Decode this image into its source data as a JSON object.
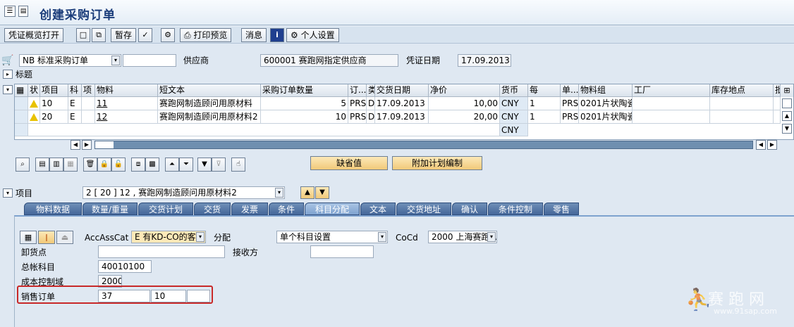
{
  "window": {
    "title": "创建采购订单"
  },
  "toolbar": {
    "buttons": [
      {
        "label": "凭证概览打开"
      },
      {
        "label": "暂存"
      },
      {
        "label": "打印预览"
      },
      {
        "label": "消息"
      },
      {
        "label": "个人设置"
      }
    ]
  },
  "header": {
    "doc_type": "NB 标准采购订单",
    "doc_type_extra": "",
    "vendor_label": "供应商",
    "vendor_value": "600001 赛跑网指定供应商",
    "doc_date_label": "凭证日期",
    "doc_date_value": "17.09.2013",
    "section_label": "标题"
  },
  "grid": {
    "columns": [
      "状",
      "项目",
      "科",
      "项",
      "物料",
      "短文本",
      "采购订单数量",
      "订...",
      "类",
      "交货日期",
      "净价",
      "货币",
      "每",
      "单...",
      "物料组",
      "工厂",
      "库存地点",
      "批"
    ],
    "rows": [
      {
        "item": "10",
        "acct": "E",
        "cat": "",
        "material": "11",
        "text": "赛跑网制造顾问用原材料",
        "qty": "5",
        "unit": "PRS",
        "type": "D",
        "date": "17.09.2013",
        "price": "10,00",
        "currency": "CNY",
        "per": "1",
        "unit2": "PRS",
        "matgroup": "0201",
        "plant": "片状陶瓷赛跑网顾问制造工厂"
      },
      {
        "item": "20",
        "acct": "E",
        "cat": "",
        "material": "12",
        "text": "赛跑网制造顾问用原材料2",
        "qty": "10",
        "unit": "PRS",
        "type": "D",
        "date": "17.09.2013",
        "price": "20,00",
        "currency": "CNY",
        "per": "1",
        "unit2": "PRS",
        "matgroup": "0201",
        "plant": "片状陶瓷赛跑网顾问制造工厂"
      },
      {
        "item": "",
        "acct": "",
        "cat": "",
        "material": "",
        "text": "",
        "qty": "",
        "unit": "",
        "type": "",
        "date": "",
        "price": "",
        "currency": "CNY",
        "per": "",
        "unit2": "",
        "matgroup": "",
        "plant": ""
      }
    ]
  },
  "actions": {
    "default_values": "缺省值",
    "additional_planning": "附加计划编制"
  },
  "item_selector": {
    "label": "项目",
    "value": "2 [ 20 ] 12 , 赛跑网制造顾问用原材料2"
  },
  "tabs": [
    {
      "label": "物料数据"
    },
    {
      "label": "数量/重量"
    },
    {
      "label": "交货计划"
    },
    {
      "label": "交货"
    },
    {
      "label": "发票"
    },
    {
      "label": "条件"
    },
    {
      "label": "科目分配",
      "active": true
    },
    {
      "label": "文本"
    },
    {
      "label": "交货地址"
    },
    {
      "label": "确认"
    },
    {
      "label": "条件控制"
    },
    {
      "label": "零售"
    }
  ],
  "account": {
    "accasscat_label": "AccAssCat",
    "accasscat_value": "E 有KD-CO的客...",
    "distribution_label": "分配",
    "distribution_value": "单个科目设置",
    "cocd_label": "CoCd",
    "cocd_value": "2000 上海赛跑...",
    "unloading_label": "卸货点",
    "unloading_value": "",
    "recipient_label": "接收方",
    "recipient_value": "",
    "gl_label": "总帐科目",
    "gl_value": "40010100",
    "co_area_label": "成本控制域",
    "co_area_value": "2000",
    "sales_order_label": "销售订单",
    "sales_order_value": "37",
    "sales_order_item": "10",
    "sales_order_extra": ""
  },
  "watermark": {
    "text": "赛 跑 网",
    "url": "www.91sap.com"
  }
}
